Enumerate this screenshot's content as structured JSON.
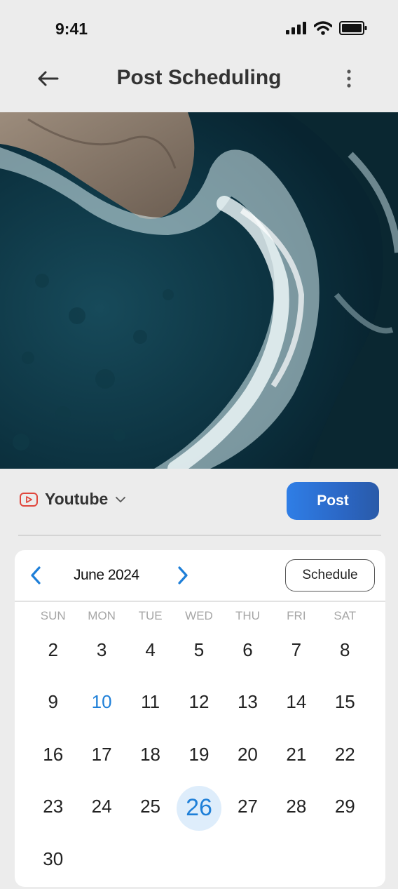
{
  "status": {
    "time": "9:41"
  },
  "app_bar": {
    "title": "Post Scheduling"
  },
  "platform": {
    "label": "Youtube",
    "post_label": "Post"
  },
  "calendar": {
    "month": "June 2024",
    "schedule_label": "Schedule",
    "weekdays": [
      "SUN",
      "MON",
      "TUE",
      "WED",
      "THU",
      "FRI",
      "SAT"
    ],
    "days": [
      "2",
      "3",
      "4",
      "5",
      "6",
      "7",
      "8",
      "9",
      "10",
      "11",
      "12",
      "13",
      "14",
      "15",
      "16",
      "17",
      "18",
      "19",
      "20",
      "21",
      "22",
      "23",
      "24",
      "25",
      "26",
      "27",
      "28",
      "29",
      "30"
    ],
    "today": "10",
    "selected": "26"
  },
  "colors": {
    "accent": "#1e7fd8",
    "post_button": "#2f7ee6",
    "selected_bg": "#deedfb",
    "youtube_red": "#e0463c"
  },
  "icons": [
    "back-arrow-icon",
    "more-vertical-icon",
    "signal-icon",
    "wifi-icon",
    "battery-icon",
    "youtube-icon",
    "chevron-down-icon",
    "chevron-left-icon",
    "chevron-right-icon"
  ]
}
